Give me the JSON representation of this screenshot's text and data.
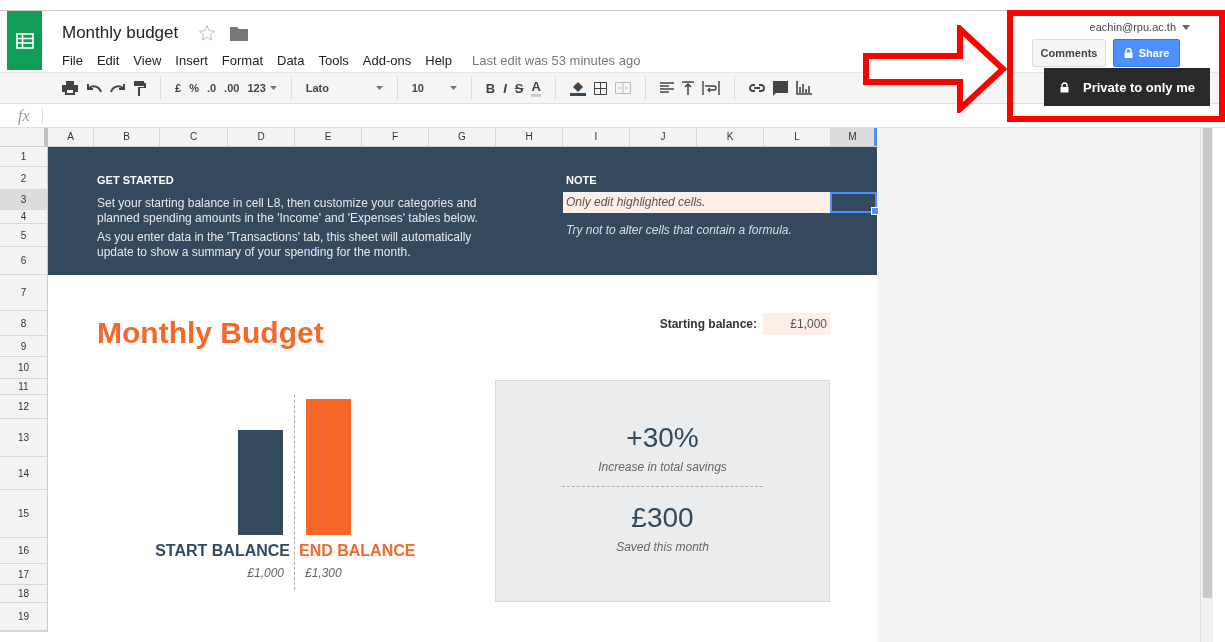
{
  "app": {
    "title": "Monthly budget",
    "starred": false,
    "menu": [
      "File",
      "Edit",
      "View",
      "Insert",
      "Format",
      "Data",
      "Tools",
      "Add-ons",
      "Help"
    ],
    "last_edit": "Last edit was 53 minutes ago"
  },
  "account": {
    "email": "eachin@rpu.ac.th",
    "comments": "Comments",
    "share": "Share",
    "tooltip": "Private to only me"
  },
  "toolbar": {
    "currency": "£",
    "percent": "%",
    "decrease_decimals": ".0",
    "increase_decimals": ".00",
    "more_formats": "123",
    "font": "Lato",
    "font_size": "10",
    "bold": "B",
    "italic": "I",
    "strike": "S",
    "text_color": "A"
  },
  "formula_bar": {
    "label": "fx"
  },
  "columns": [
    {
      "label": "A",
      "selected": false
    },
    {
      "label": "B",
      "selected": false
    },
    {
      "label": "C",
      "selected": false
    },
    {
      "label": "D",
      "selected": false
    },
    {
      "label": "E",
      "selected": false
    },
    {
      "label": "F",
      "selected": false
    },
    {
      "label": "G",
      "selected": false
    },
    {
      "label": "H",
      "selected": false
    },
    {
      "label": "I",
      "selected": false
    },
    {
      "label": "J",
      "selected": false
    },
    {
      "label": "K",
      "selected": false
    },
    {
      "label": "L",
      "selected": false
    },
    {
      "label": "M",
      "selected": true
    }
  ],
  "rows": [
    {
      "label": "1",
      "selected": false
    },
    {
      "label": "2",
      "selected": false
    },
    {
      "label": "3",
      "selected": true
    },
    {
      "label": "4",
      "selected": false
    },
    {
      "label": "5",
      "selected": false
    },
    {
      "label": "6",
      "selected": false
    },
    {
      "label": "7",
      "selected": false
    },
    {
      "label": "8",
      "selected": false
    },
    {
      "label": "9",
      "selected": false
    },
    {
      "label": "10",
      "selected": false
    },
    {
      "label": "11",
      "selected": false
    },
    {
      "label": "12",
      "selected": false
    },
    {
      "label": "13",
      "selected": false
    },
    {
      "label": "14",
      "selected": false
    },
    {
      "label": "15",
      "selected": false
    },
    {
      "label": "16",
      "selected": false
    },
    {
      "label": "17",
      "selected": false
    },
    {
      "label": "18",
      "selected": false
    },
    {
      "label": "19",
      "selected": false
    }
  ],
  "banner": {
    "heading": "GET STARTED",
    "paragraphs": [
      [
        "Set your starting balance in cell L8, then customize your categories and",
        "planned spending amounts in the 'Income' and 'Expenses' tables below."
      ],
      [
        "As you enter data in the 'Transactions' tab, this sheet will automatically",
        "update to show a summary of your spending for the month."
      ]
    ],
    "note_heading": "NOTE",
    "note_cell": "Only edit highlighted cells.",
    "note_text": "Try not to alter cells that contain a formula."
  },
  "budget": {
    "title": "Monthly Budget",
    "starting_label": "Starting balance:",
    "starting_value": "£1,000",
    "start_label": "START BALANCE",
    "start_value": "£1,000",
    "end_label": "END BALANCE",
    "end_value": "£1,300"
  },
  "summary": [
    {
      "value": "+30%",
      "caption": "Increase in total savings"
    },
    {
      "value": "£300",
      "caption": "Saved this month"
    }
  ]
}
